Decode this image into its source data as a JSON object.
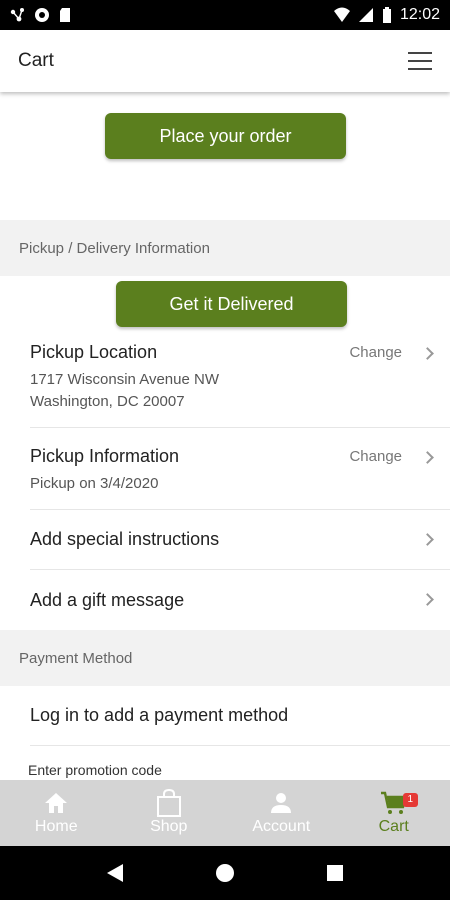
{
  "status_bar": {
    "time": "12:02"
  },
  "app_bar": {
    "title": "Cart",
    "menu_icon": "hamburger-menu-icon"
  },
  "actions": {
    "place_order_label": "Place your order",
    "get_delivered_label": "Get it Delivered"
  },
  "pickup_section": {
    "header": "Pickup / Delivery Information",
    "location": {
      "title": "Pickup Location",
      "line1": "1717 Wisconsin Avenue NW",
      "line2": "Washington, DC 20007",
      "change_label": "Change"
    },
    "info": {
      "title": "Pickup Information",
      "subtitle": "Pickup on 3/4/2020",
      "change_label": "Change"
    },
    "special_instructions": "Add special instructions",
    "gift_message": "Add a gift message"
  },
  "payment_section": {
    "header": "Payment Method",
    "login_label": "Log in to add a payment method",
    "promo_label": "Enter promotion code"
  },
  "bottom_nav": {
    "items": [
      {
        "label": "Home",
        "icon": "home-icon"
      },
      {
        "label": "Shop",
        "icon": "shopping-bag-icon"
      },
      {
        "label": "Account",
        "icon": "person-icon"
      },
      {
        "label": "Cart",
        "icon": "cart-icon",
        "badge": "1",
        "active": true
      }
    ]
  },
  "colors": {
    "accent": "#5b7f1e",
    "badge": "#e53935",
    "section_bg": "#f2f2f2"
  }
}
